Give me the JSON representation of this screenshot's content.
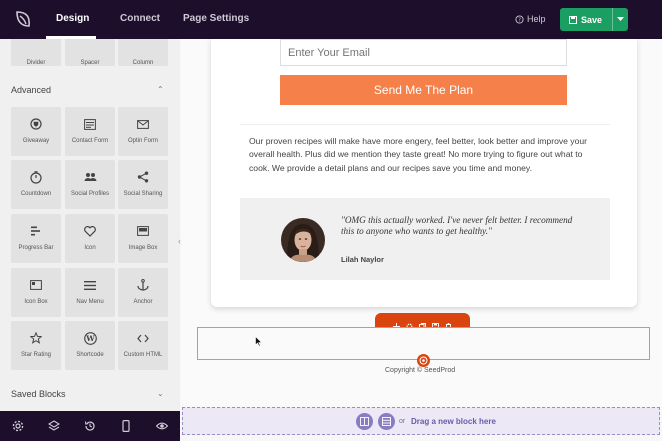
{
  "topbar": {
    "tabs": [
      "Design",
      "Connect",
      "Page Settings"
    ],
    "help_label": "Help",
    "save_label": "Save"
  },
  "sidebar": {
    "top_row": [
      "Divider",
      "Spacer",
      "Column"
    ],
    "advanced_title": "Advanced",
    "advanced_blocks": [
      {
        "label": "Giveaway",
        "icon": "trophy-icon"
      },
      {
        "label": "Contact Form",
        "icon": "contact-form-icon"
      },
      {
        "label": "Optin Form",
        "icon": "envelope-icon"
      },
      {
        "label": "Countdown",
        "icon": "stopwatch-icon"
      },
      {
        "label": "Social Profiles",
        "icon": "social-profiles-icon"
      },
      {
        "label": "Social Sharing",
        "icon": "share-icon"
      },
      {
        "label": "Progress Bar",
        "icon": "progress-bar-icon"
      },
      {
        "label": "Icon",
        "icon": "heart-icon"
      },
      {
        "label": "Image Box",
        "icon": "image-box-icon"
      },
      {
        "label": "Icon Box",
        "icon": "icon-box-icon"
      },
      {
        "label": "Nav Menu",
        "icon": "menu-icon"
      },
      {
        "label": "Anchor",
        "icon": "anchor-icon"
      },
      {
        "label": "Star Rating",
        "icon": "star-icon"
      },
      {
        "label": "Shortcode",
        "icon": "wordpress-icon"
      },
      {
        "label": "Custom HTML",
        "icon": "code-icon"
      }
    ],
    "saved_blocks_title": "Saved Blocks"
  },
  "canvas": {
    "email_placeholder": "Enter Your Email",
    "cta_label": "Send Me The Plan",
    "paragraph": "Our proven recipes will make have more engery, feel better, look better and improve your overall health. Plus did we mention they taste great! No more trying to figure out what to cook. We provide a detail plans and our recipes save you time and money.",
    "quote": "\"OMG this actually worked.  I've never felt better. I recommend this to anyone who wants to get healthy.\"",
    "author": "Lilah Naylor",
    "copyright": "Copyright © SeedProd",
    "dropzone_or": "or",
    "dropzone_text": "Drag a new block here"
  },
  "colors": {
    "topbar_bg": "#1d0f2b",
    "save_green": "#1b9e62",
    "cta_orange": "#f5804a",
    "toolbar_red": "#d9440f",
    "dropzone_purple": "#8a7cc1"
  }
}
